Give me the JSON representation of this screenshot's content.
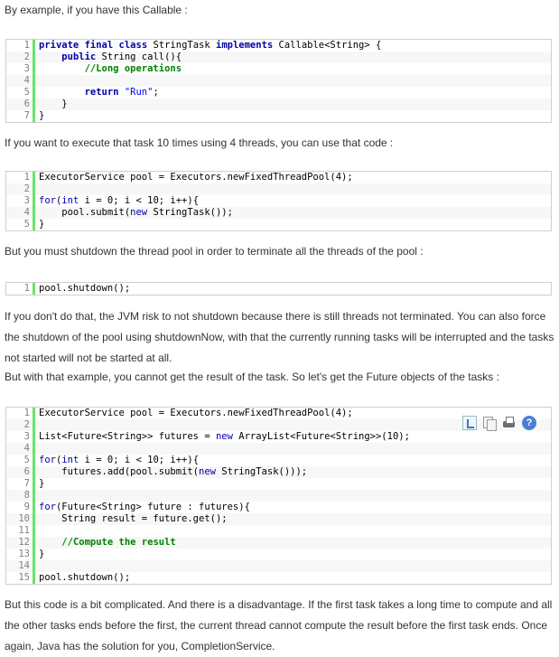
{
  "paragraphs": {
    "p1": "By example, if you have this Callable :",
    "p2": "If you want to execute that task 10 times using 4 threads, you can use that code :",
    "p3": "But you must shutdown the thread pool in order to terminate all the threads of the pool :",
    "p4": "If you don't do that, the JVM risk to not shutdown because there is still threads not terminated. You can also force the shutdown of the pool using shutdownNow, with that the currently running tasks will be interrupted and the tasks not started will not be started at all.",
    "p5": "But with that example, you cannot get the result of the task. So let's get the Future objects of the tasks :",
    "p6": "But this code is a bit complicated. And there is a disadvantage. If the first task takes a long time to compute and all the other tasks ends before the first, the current thread cannot compute the result before the first task ends. Once again, Java has the solution for you, CompletionService."
  },
  "toolbar": {
    "help_label": "?"
  },
  "code_blocks": [
    {
      "lines": [
        {
          "n": "1",
          "html": "<span class=\"kw\">private</span> <span class=\"kw\">final</span> <span class=\"kw\">class</span> StringTask <span class=\"kw\">implements</span> Callable&lt;String&gt; {"
        },
        {
          "n": "2",
          "html": "    <span class=\"kw\">public</span> String call(){"
        },
        {
          "n": "3",
          "html": "        <span class=\"cm\">//Long operations</span>"
        },
        {
          "n": "4",
          "html": ""
        },
        {
          "n": "5",
          "html": "        <span class=\"kw\">return</span> <span class=\"str\">\"Run\"</span>;"
        },
        {
          "n": "6",
          "html": "    }"
        },
        {
          "n": "7",
          "html": "}"
        }
      ]
    },
    {
      "lines": [
        {
          "n": "1",
          "html": "ExecutorService pool = Executors.newFixedThreadPool(4);"
        },
        {
          "n": "2",
          "html": ""
        },
        {
          "n": "3",
          "html": "<span class=\"kw2\">for</span>(<span class=\"kw2\">int</span> i = 0; i &lt; 10; i++){"
        },
        {
          "n": "4",
          "html": "    pool.submit(<span class=\"kw2\">new</span> StringTask());"
        },
        {
          "n": "5",
          "html": "}"
        }
      ]
    },
    {
      "lines": [
        {
          "n": "1",
          "html": "pool.shutdown();"
        }
      ]
    },
    {
      "lines": [
        {
          "n": "1",
          "html": "ExecutorService pool = Executors.newFixedThreadPool(4);"
        },
        {
          "n": "2",
          "html": ""
        },
        {
          "n": "3",
          "html": "List&lt;Future&lt;String&gt;&gt; futures = <span class=\"kw2\">new</span> ArrayList&lt;Future&lt;String&gt;&gt;(10);"
        },
        {
          "n": "4",
          "html": ""
        },
        {
          "n": "5",
          "html": "<span class=\"kw2\">for</span>(<span class=\"kw2\">int</span> i = 0; i &lt; 10; i++){"
        },
        {
          "n": "6",
          "html": "    futures.add(pool.submit(<span class=\"kw2\">new</span> StringTask()));"
        },
        {
          "n": "7",
          "html": "}"
        },
        {
          "n": "8",
          "html": ""
        },
        {
          "n": "9",
          "html": "<span class=\"kw2\">for</span>(Future&lt;String&gt; future : futures){"
        },
        {
          "n": "10",
          "html": "    String result = future.get();"
        },
        {
          "n": "11",
          "html": ""
        },
        {
          "n": "12",
          "html": "    <span class=\"cm\">//Compute the result</span>"
        },
        {
          "n": "13",
          "html": "}"
        },
        {
          "n": "14",
          "html": ""
        },
        {
          "n": "15",
          "html": "pool.shutdown();"
        }
      ]
    }
  ]
}
